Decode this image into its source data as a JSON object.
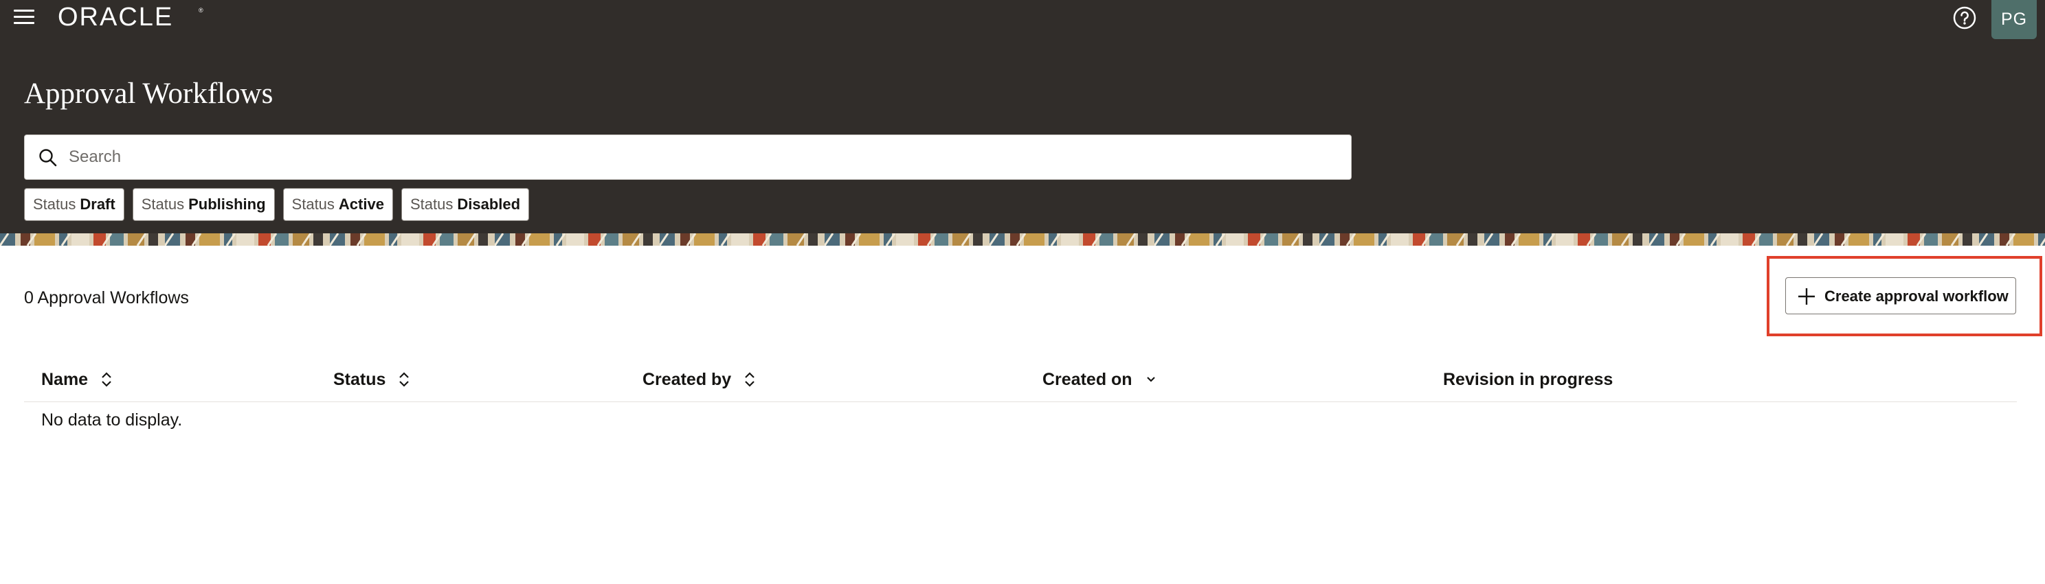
{
  "header": {
    "brand": "ORACLE",
    "menu_icon": "hamburger-menu-icon",
    "help_icon": "help-circle-icon",
    "user_initials": "PG"
  },
  "page": {
    "title": "Approval Workflows"
  },
  "search": {
    "placeholder": "Search",
    "value": ""
  },
  "filters": [
    {
      "key": "Status",
      "value": "Draft"
    },
    {
      "key": "Status",
      "value": "Publishing"
    },
    {
      "key": "Status",
      "value": "Active"
    },
    {
      "key": "Status",
      "value": "Disabled"
    }
  ],
  "results": {
    "count_label": "0 Approval Workflows",
    "create_button": "Create approval workflow"
  },
  "table": {
    "columns": [
      {
        "label": "Name",
        "sort": "unsorted"
      },
      {
        "label": "Status",
        "sort": "unsorted"
      },
      {
        "label": "Created by",
        "sort": "unsorted"
      },
      {
        "label": "Created on",
        "sort": "descending"
      },
      {
        "label": "Revision in progress",
        "sort": "none"
      }
    ],
    "empty_message": "No data to display."
  },
  "colors": {
    "header_bg": "#312d2a",
    "highlight": "#e0402b",
    "avatar_bg": "#4f6f6a"
  }
}
